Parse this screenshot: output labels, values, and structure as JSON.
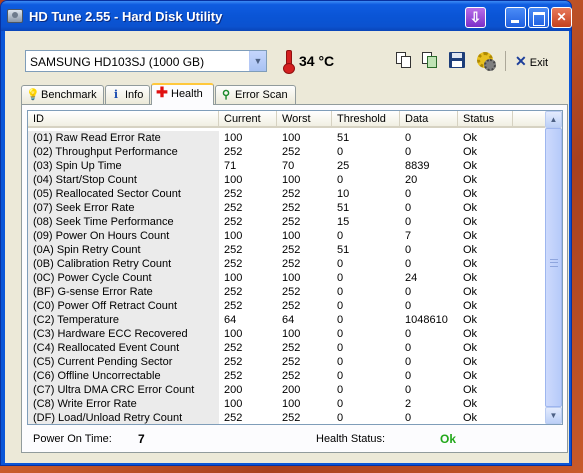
{
  "window": {
    "title": "HD Tune 2.55 - Hard Disk Utility"
  },
  "toolbar": {
    "drive": "SAMSUNG HD103SJ (1000 GB)",
    "temperature": "34 °C",
    "exit_label": "Exit",
    "icons": [
      "copy-text-icon",
      "copy-screenshot-icon",
      "save-icon",
      "options-icon",
      "exit-icon"
    ]
  },
  "tabs": [
    {
      "label": "Benchmark",
      "icon": "lightbulb-icon",
      "active": false
    },
    {
      "label": "Info",
      "icon": "info-icon",
      "active": false
    },
    {
      "label": "Health",
      "icon": "health-plus-icon",
      "active": true
    },
    {
      "label": "Error Scan",
      "icon": "magnifier-icon",
      "active": false
    }
  ],
  "table": {
    "columns": [
      "ID",
      "Current",
      "Worst",
      "Threshold",
      "Data",
      "Status"
    ],
    "rows": [
      [
        "(01) Raw Read Error Rate",
        "100",
        "100",
        "51",
        "0",
        "Ok"
      ],
      [
        "(02) Throughput Performance",
        "252",
        "252",
        "0",
        "0",
        "Ok"
      ],
      [
        "(03) Spin Up Time",
        "71",
        "70",
        "25",
        "8839",
        "Ok"
      ],
      [
        "(04) Start/Stop Count",
        "100",
        "100",
        "0",
        "20",
        "Ok"
      ],
      [
        "(05) Reallocated Sector Count",
        "252",
        "252",
        "10",
        "0",
        "Ok"
      ],
      [
        "(07) Seek Error Rate",
        "252",
        "252",
        "51",
        "0",
        "Ok"
      ],
      [
        "(08) Seek Time Performance",
        "252",
        "252",
        "15",
        "0",
        "Ok"
      ],
      [
        "(09) Power On Hours Count",
        "100",
        "100",
        "0",
        "7",
        "Ok"
      ],
      [
        "(0A) Spin Retry Count",
        "252",
        "252",
        "51",
        "0",
        "Ok"
      ],
      [
        "(0B) Calibration Retry Count",
        "252",
        "252",
        "0",
        "0",
        "Ok"
      ],
      [
        "(0C) Power Cycle Count",
        "100",
        "100",
        "0",
        "24",
        "Ok"
      ],
      [
        "(BF) G-sense Error Rate",
        "252",
        "252",
        "0",
        "0",
        "Ok"
      ],
      [
        "(C0) Power Off Retract Count",
        "252",
        "252",
        "0",
        "0",
        "Ok"
      ],
      [
        "(C2) Temperature",
        "64",
        "64",
        "0",
        "1048610",
        "Ok"
      ],
      [
        "(C3) Hardware ECC Recovered",
        "100",
        "100",
        "0",
        "0",
        "Ok"
      ],
      [
        "(C4) Reallocated Event Count",
        "252",
        "252",
        "0",
        "0",
        "Ok"
      ],
      [
        "(C5) Current Pending Sector",
        "252",
        "252",
        "0",
        "0",
        "Ok"
      ],
      [
        "(C6) Offline Uncorrectable",
        "252",
        "252",
        "0",
        "0",
        "Ok"
      ],
      [
        "(C7) Ultra DMA CRC Error Count",
        "200",
        "200",
        "0",
        "0",
        "Ok"
      ],
      [
        "(C8) Write Error Rate",
        "100",
        "100",
        "0",
        "2",
        "Ok"
      ],
      [
        "(DF) Load/Unload Retry Count",
        "252",
        "252",
        "0",
        "0",
        "Ok"
      ]
    ]
  },
  "status": {
    "power_on_label": "Power On Time:",
    "power_on_value": "7",
    "health_label": "Health Status:",
    "health_value": "Ok",
    "health_color": "#22a81a"
  }
}
